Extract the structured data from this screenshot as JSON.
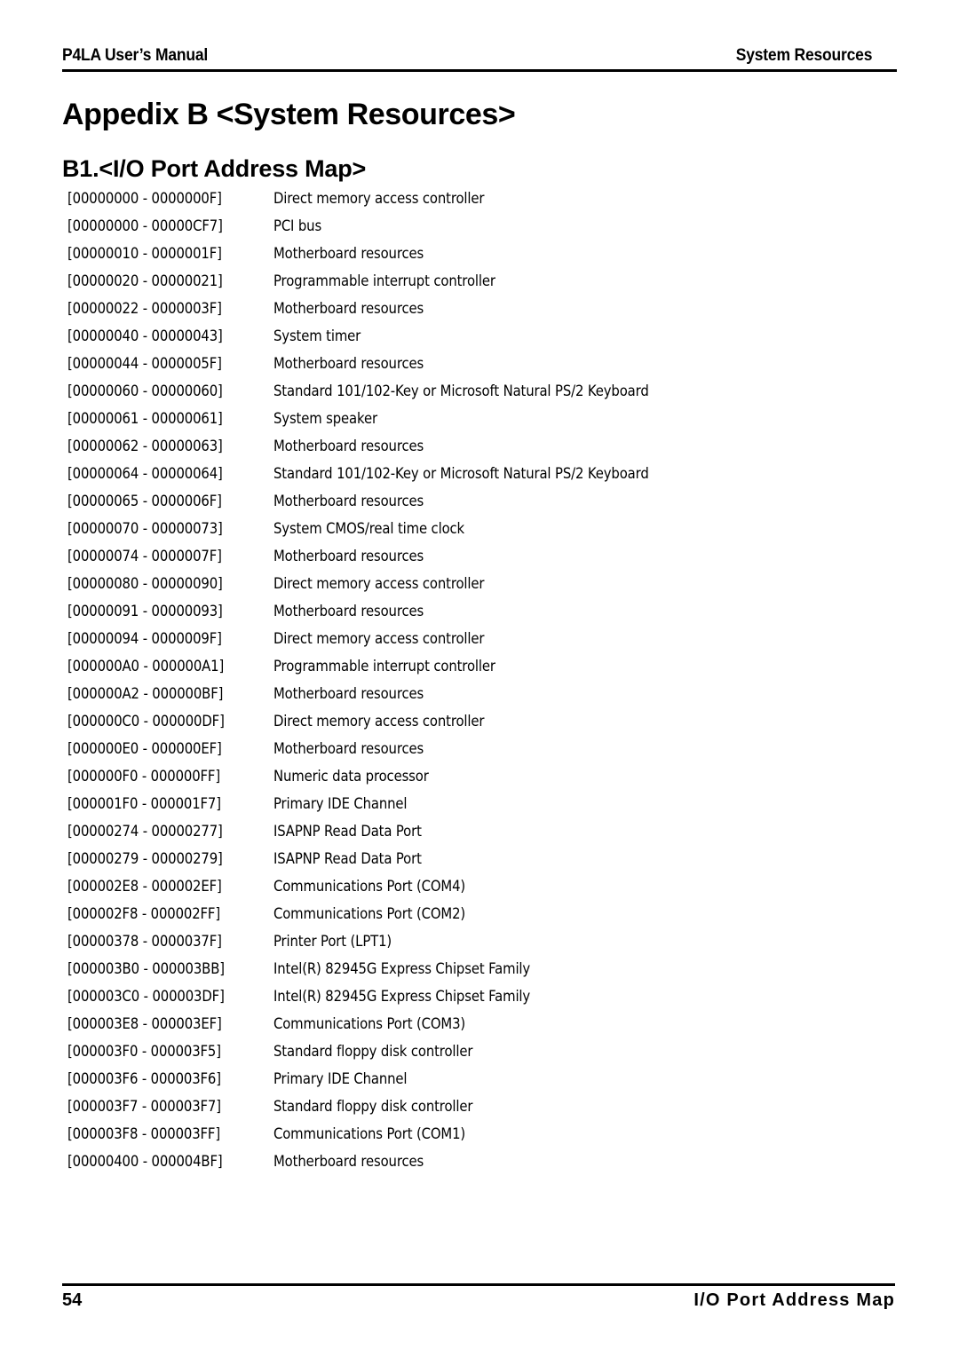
{
  "header": {
    "left": "P4LA User’s Manual",
    "right": "System Resources"
  },
  "titles": {
    "appendix": "Appedix B <System Resources>",
    "section": "B1.<I/O Port Address Map>"
  },
  "footer": {
    "page_number": "54",
    "section_label": "I/O Port Address Map"
  },
  "io_port_map": [
    {
      "range": "[00000000 - 0000000F]",
      "device": "Direct memory access controller"
    },
    {
      "range": "[00000000 - 00000CF7]",
      "device": "PCI bus"
    },
    {
      "range": "[00000010 - 0000001F]",
      "device": "Motherboard resources"
    },
    {
      "range": "[00000020 - 00000021]",
      "device": "Programmable interrupt controller"
    },
    {
      "range": "[00000022 - 0000003F]",
      "device": "Motherboard resources"
    },
    {
      "range": "[00000040 - 00000043]",
      "device": "System timer"
    },
    {
      "range": "[00000044 - 0000005F]",
      "device": "Motherboard resources"
    },
    {
      "range": "[00000060 - 00000060]",
      "device": "Standard 101/102-Key or Microsoft Natural PS/2 Keyboard"
    },
    {
      "range": "[00000061 - 00000061]",
      "device": "System speaker"
    },
    {
      "range": "[00000062 - 00000063]",
      "device": "Motherboard resources"
    },
    {
      "range": "[00000064 - 00000064]",
      "device": "Standard 101/102-Key or Microsoft Natural PS/2 Keyboard"
    },
    {
      "range": "[00000065 - 0000006F]",
      "device": "Motherboard resources"
    },
    {
      "range": "[00000070 - 00000073]",
      "device": "System CMOS/real time clock"
    },
    {
      "range": "[00000074 - 0000007F]",
      "device": "Motherboard resources"
    },
    {
      "range": "[00000080 - 00000090]",
      "device": "Direct memory access controller"
    },
    {
      "range": "[00000091 - 00000093]",
      "device": "Motherboard resources"
    },
    {
      "range": "[00000094 - 0000009F]",
      "device": "Direct memory access controller"
    },
    {
      "range": "[000000A0 - 000000A1]",
      "device": "Programmable interrupt controller"
    },
    {
      "range": "[000000A2 - 000000BF]",
      "device": "Motherboard resources"
    },
    {
      "range": "[000000C0 - 000000DF]",
      "device": "Direct memory access controller"
    },
    {
      "range": "[000000E0 - 000000EF]",
      "device": "Motherboard resources"
    },
    {
      "range": "[000000F0 - 000000FF]",
      "device": "Numeric data processor"
    },
    {
      "range": "[000001F0 - 000001F7]",
      "device": "Primary IDE Channel"
    },
    {
      "range": "[00000274 - 00000277]",
      "device": "ISAPNP Read Data Port"
    },
    {
      "range": "[00000279 - 00000279]",
      "device": "ISAPNP Read Data Port"
    },
    {
      "range": "[000002E8 - 000002EF]",
      "device": "Communications Port (COM4)"
    },
    {
      "range": "[000002F8 - 000002FF]",
      "device": "Communications Port (COM2)"
    },
    {
      "range": "[00000378 - 0000037F]",
      "device": "Printer Port (LPT1)"
    },
    {
      "range": "[000003B0 - 000003BB]",
      "device": "Intel(R) 82945G Express Chipset Family"
    },
    {
      "range": "[000003C0 - 000003DF]",
      "device": "Intel(R) 82945G Express Chipset Family"
    },
    {
      "range": "[000003E8 - 000003EF]",
      "device": "Communications Port (COM3)"
    },
    {
      "range": "[000003F0 - 000003F5]",
      "device": "Standard floppy disk controller"
    },
    {
      "range": "[000003F6 - 000003F6]",
      "device": "Primary IDE Channel"
    },
    {
      "range": "[000003F7 - 000003F7]",
      "device": "Standard floppy disk controller"
    },
    {
      "range": "[000003F8 - 000003FF]",
      "device": "Communications Port (COM1)"
    },
    {
      "range": "[00000400 - 000004BF]",
      "device": "Motherboard resources"
    }
  ]
}
